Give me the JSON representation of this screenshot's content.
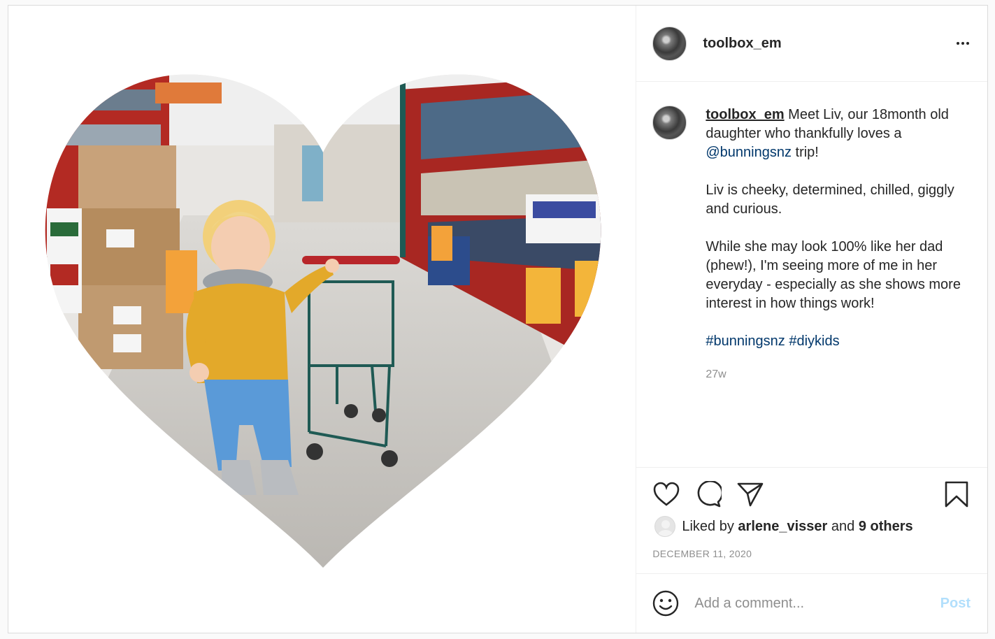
{
  "post": {
    "username": "toolbox_em",
    "more_icon": "more-horizontal-icon",
    "caption": {
      "line1_text": " Meet Liv, our 18month old daughter who thankfully loves a ",
      "mention": "@bunningsnz",
      "line1_end": " trip!",
      "para2": "Liv is cheeky, determined, chilled, giggly and curious.",
      "para3": "While she may look 100% like her dad (phew!), I'm seeing more of me in her everyday - especially as she shows more interest in how things work!",
      "hashtag1": "#bunningsnz",
      "hashtag2": "#diykids"
    },
    "time_ago": "27w",
    "actions": {
      "like_icon": "heart-icon",
      "comment_icon": "comment-icon",
      "share_icon": "paper-plane-icon",
      "save_icon": "bookmark-icon"
    },
    "likes": {
      "prefix": "Liked by ",
      "user": "arlene_visser",
      "middle": " and ",
      "others": "9 others"
    },
    "date": "DECEMBER 11, 2020",
    "comment": {
      "placeholder": "Add a comment...",
      "post_label": "Post",
      "emoji_icon": "smiley-icon"
    }
  }
}
